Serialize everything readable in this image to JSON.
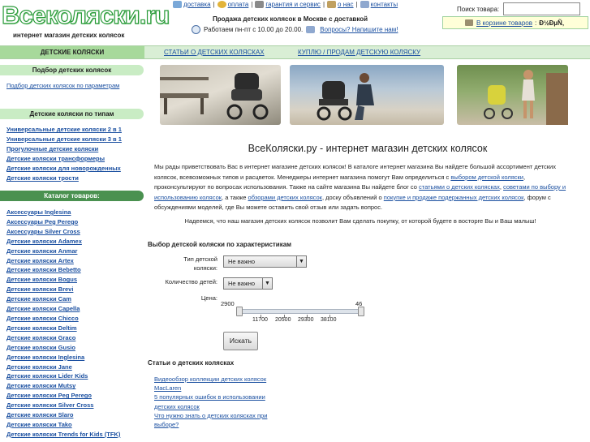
{
  "header": {
    "logo_text": "Всеколяски.ru",
    "logo_sub": "интернет магазин детских колясок",
    "top_links": [
      {
        "label": "доставка",
        "icon": "truck-icon",
        "color": "#7aa8d8"
      },
      {
        "label": "оплата",
        "icon": "coins-icon",
        "color": "#e2b33a"
      },
      {
        "label": "гарантия и сервис",
        "icon": "wrench-icon",
        "color": "#8a8a8a"
      },
      {
        "label": "о нас",
        "icon": "info-icon",
        "color": "#c0a060"
      },
      {
        "label": "контакты",
        "icon": "envelope-icon",
        "color": "#8fa8cf"
      }
    ],
    "promo": "Продажа детских колясок в Москве с доставкой",
    "hours": "Работаем пн-пт с 10.00 до 20.00.",
    "question_link": "Вопросы? Напишите нам!",
    "search_label": "Поиск товара:",
    "search_value": "",
    "cart_link": "В корзине товаров",
    "cart_value": "Ð½ÐµÑ‚"
  },
  "nav": {
    "active": "ДЕТСКИЕ КОЛЯСКИ",
    "links": [
      "Статьи о детских колясках",
      "Куплю / продам детскую коляску"
    ]
  },
  "sidebar": {
    "pick_head": "Подбор детских колясок",
    "pick_link": "Подбор детских колясок по параметрам",
    "types_head": "Детские коляски по типам",
    "types": [
      "Универсальные детские коляски 2 в 1",
      "Универсальные детские коляски 3 в 1",
      "Прогулочные детские коляски",
      "Детские коляски трансформеры",
      "Детские коляски для новорожденных",
      "Детские коляски трости"
    ],
    "catalog_head": "Каталог товаров:",
    "catalog": [
      "Аксессуары Inglesina",
      "Аксессуары Peg Perego",
      "Аксессуары Silver Cross",
      "Детские коляски Adamex",
      "Детские коляски Anmar",
      "Детские коляски Artex",
      "Детские коляски Bebetto",
      "Детские коляски Bogus",
      "Детские коляски Brevi",
      "Детские коляски Cam",
      "Детские коляски Capella",
      "Детские коляски Chicco",
      "Детские коляски Deltim",
      "Детские коляски Graco",
      "Детские коляски Gusio",
      "Детские коляски Inglesina",
      "Детские коляски Jane",
      "Детские коляски Lider Kids",
      "Детские коляски Mutsy",
      "Детские коляски Peg Perego",
      "Детские коляски Silver Cross",
      "Детские коляски Slaro",
      "Детские коляски Tako",
      "Детские коляски Trends for Kids (TFK)"
    ]
  },
  "main": {
    "title": "ВсеКоляски.ру - интернет магазин детских колясок",
    "intro": {
      "p1": "Мы рады приветствовать Вас в интернет магазине детских колясок! В каталоге интернет магазина Вы найдете большой ассортимент детских колясок, всевозможных типов и расцветок. Менеджеры интернет магазина помогут Вам определиться с ",
      "l1": "выбором детской коляски",
      "p2": ", проконсультируют по вопросах использования. Также на сайте магазина Вы найдете блог со ",
      "l2": "статьями о детских колясках",
      "p3": ", ",
      "l3": "советами по выбору и использованию колясок",
      "p4": ", а также ",
      "l4": "обзорами детских колясок",
      "p5": ", доску объявлений о ",
      "l5": "покупке и продаже подержанных детских колясок",
      "p6": ", форум с обсуждениями моделей, где Вы можете оставить свой отзыв или задать вопрос."
    },
    "thanks": "Надеемся, что наш магазин детских колясок позволит Вам сделать покупку, от которой будете в восторге Вы и Ваш малыш!",
    "filter": {
      "head": "Выбор детской коляски по характеристикам",
      "type_label": "Тип детской коляски:",
      "type_value": "Не важно",
      "count_label": "Количество детей:",
      "count_value": "Не важно",
      "price_label": "Цена:",
      "price_min": "2900",
      "price_max": "46",
      "ticks": [
        "11700",
        "20500",
        "29300",
        "38100"
      ],
      "search_button": "Искать"
    },
    "articles_head": "Статьи о детских колясках",
    "articles": [
      "Видеообзор коллекции детских колясок MacLaren",
      "5 популярных ошибок в использовании детских колясок",
      "Что нужно знать о детских колясках при выборе?"
    ]
  },
  "colors": {
    "nav_bg": "#d9eed5",
    "nav_active": "#a7d99b",
    "sidebar_head": "#c9ecc4",
    "sidebar_head_dark": "#4a9150",
    "link": "#1a4fa0",
    "cart_bg": "#ffffd8"
  }
}
